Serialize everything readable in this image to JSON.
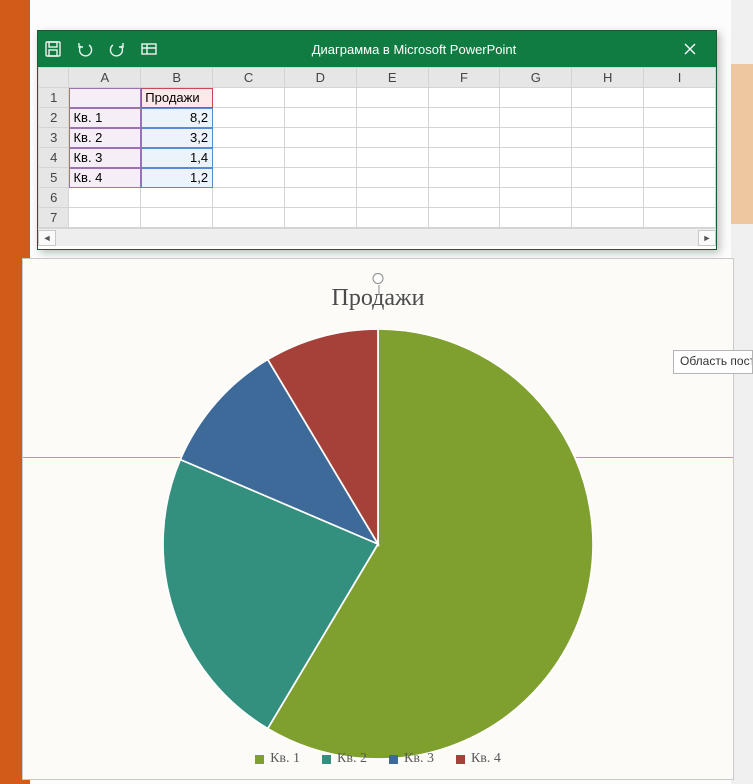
{
  "window": {
    "title": "Диаграмма в Microsoft PowerPoint"
  },
  "sheet": {
    "columns": [
      "A",
      "B",
      "C",
      "D",
      "E",
      "F",
      "G",
      "H",
      "I"
    ],
    "rowNumbers": [
      "1",
      "2",
      "3",
      "4",
      "5",
      "6",
      "7"
    ],
    "headerLabel": "Продажи",
    "rows": [
      {
        "cat": "Кв. 1",
        "val": "8,2"
      },
      {
        "cat": "Кв. 2",
        "val": "3,2"
      },
      {
        "cat": "Кв. 3",
        "val": "1,4"
      },
      {
        "cat": "Кв. 4",
        "val": "1,2"
      }
    ]
  },
  "tooltip": "Область пост",
  "chart": {
    "title": "Продажи",
    "legend": [
      "Кв. 1",
      "Кв. 2",
      "Кв. 3",
      "Кв. 4"
    ],
    "colors": [
      "#7fa02f",
      "#338f7e",
      "#3d6a99",
      "#a64139"
    ]
  },
  "chart_data": {
    "type": "pie",
    "title": "Продажи",
    "series_name": "Продажи",
    "categories": [
      "Кв. 1",
      "Кв. 2",
      "Кв. 3",
      "Кв. 4"
    ],
    "values": [
      8.2,
      3.2,
      1.4,
      1.2
    ],
    "colors": [
      "#7fa02f",
      "#338f7e",
      "#3d6a99",
      "#a64139"
    ],
    "legend_position": "bottom"
  }
}
